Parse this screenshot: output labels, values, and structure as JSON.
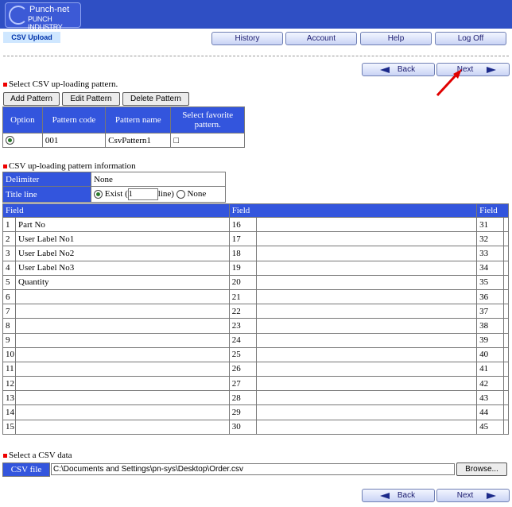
{
  "header": {
    "logo_line1": "Punch-net",
    "logo_line2": "PUNCH INDUSTRY",
    "tab_label": "CSV Upload"
  },
  "nav": {
    "history": "History",
    "account": "Account",
    "help": "Help",
    "logoff": "Log Off"
  },
  "pager": {
    "back": "Back",
    "next": "Next"
  },
  "pattern_section": {
    "title": "Select CSV up-loading pattern.",
    "buttons": {
      "add": "Add Pattern",
      "edit": "Edit Pattern",
      "delete": "Delete Pattern"
    },
    "headers": {
      "option": "Option",
      "code": "Pattern code",
      "name": "Pattern name",
      "fav": "Select favorite pattern."
    },
    "rows": [
      {
        "code": "001",
        "name": "CsvPattern1",
        "fav_mark": "□"
      }
    ]
  },
  "info_section": {
    "title": "CSV up-loading pattern information",
    "delimiter_label": "Delimiter",
    "delimiter_value": "None",
    "titleline_label": "Title line",
    "exist_label": "Exist (",
    "line_value": "1",
    "line_suffix": "line)",
    "none_label": "None"
  },
  "fields": {
    "header": "Field",
    "col1": [
      [
        "1",
        "Part No"
      ],
      [
        "2",
        "User Label No1"
      ],
      [
        "3",
        "User Label No2"
      ],
      [
        "4",
        "User Label No3"
      ],
      [
        "5",
        "Quantity"
      ],
      [
        "6",
        ""
      ],
      [
        "7",
        ""
      ],
      [
        "8",
        ""
      ],
      [
        "9",
        ""
      ],
      [
        "10",
        ""
      ],
      [
        "11",
        ""
      ],
      [
        "12",
        ""
      ],
      [
        "13",
        ""
      ],
      [
        "14",
        ""
      ],
      [
        "15",
        ""
      ]
    ],
    "col2": [
      [
        "16",
        ""
      ],
      [
        "17",
        ""
      ],
      [
        "18",
        ""
      ],
      [
        "19",
        ""
      ],
      [
        "20",
        ""
      ],
      [
        "21",
        ""
      ],
      [
        "22",
        ""
      ],
      [
        "23",
        ""
      ],
      [
        "24",
        ""
      ],
      [
        "25",
        ""
      ],
      [
        "26",
        ""
      ],
      [
        "27",
        ""
      ],
      [
        "28",
        ""
      ],
      [
        "29",
        ""
      ],
      [
        "30",
        ""
      ]
    ],
    "col3": [
      [
        "31",
        ""
      ],
      [
        "32",
        ""
      ],
      [
        "33",
        ""
      ],
      [
        "34",
        ""
      ],
      [
        "35",
        ""
      ],
      [
        "36",
        ""
      ],
      [
        "37",
        ""
      ],
      [
        "38",
        ""
      ],
      [
        "39",
        ""
      ],
      [
        "40",
        ""
      ],
      [
        "41",
        ""
      ],
      [
        "42",
        ""
      ],
      [
        "43",
        ""
      ],
      [
        "44",
        ""
      ],
      [
        "45",
        ""
      ]
    ]
  },
  "csv_section": {
    "title": "Select a CSV data",
    "label": "CSV file",
    "path": "C:\\Documents and Settings\\pn-sys\\Desktop\\Order.csv",
    "browse": "Browse..."
  },
  "colors": {
    "header_blue": "#2f4fc4",
    "table_header": "#3355dd",
    "annotation_arrow": "#e00000"
  }
}
